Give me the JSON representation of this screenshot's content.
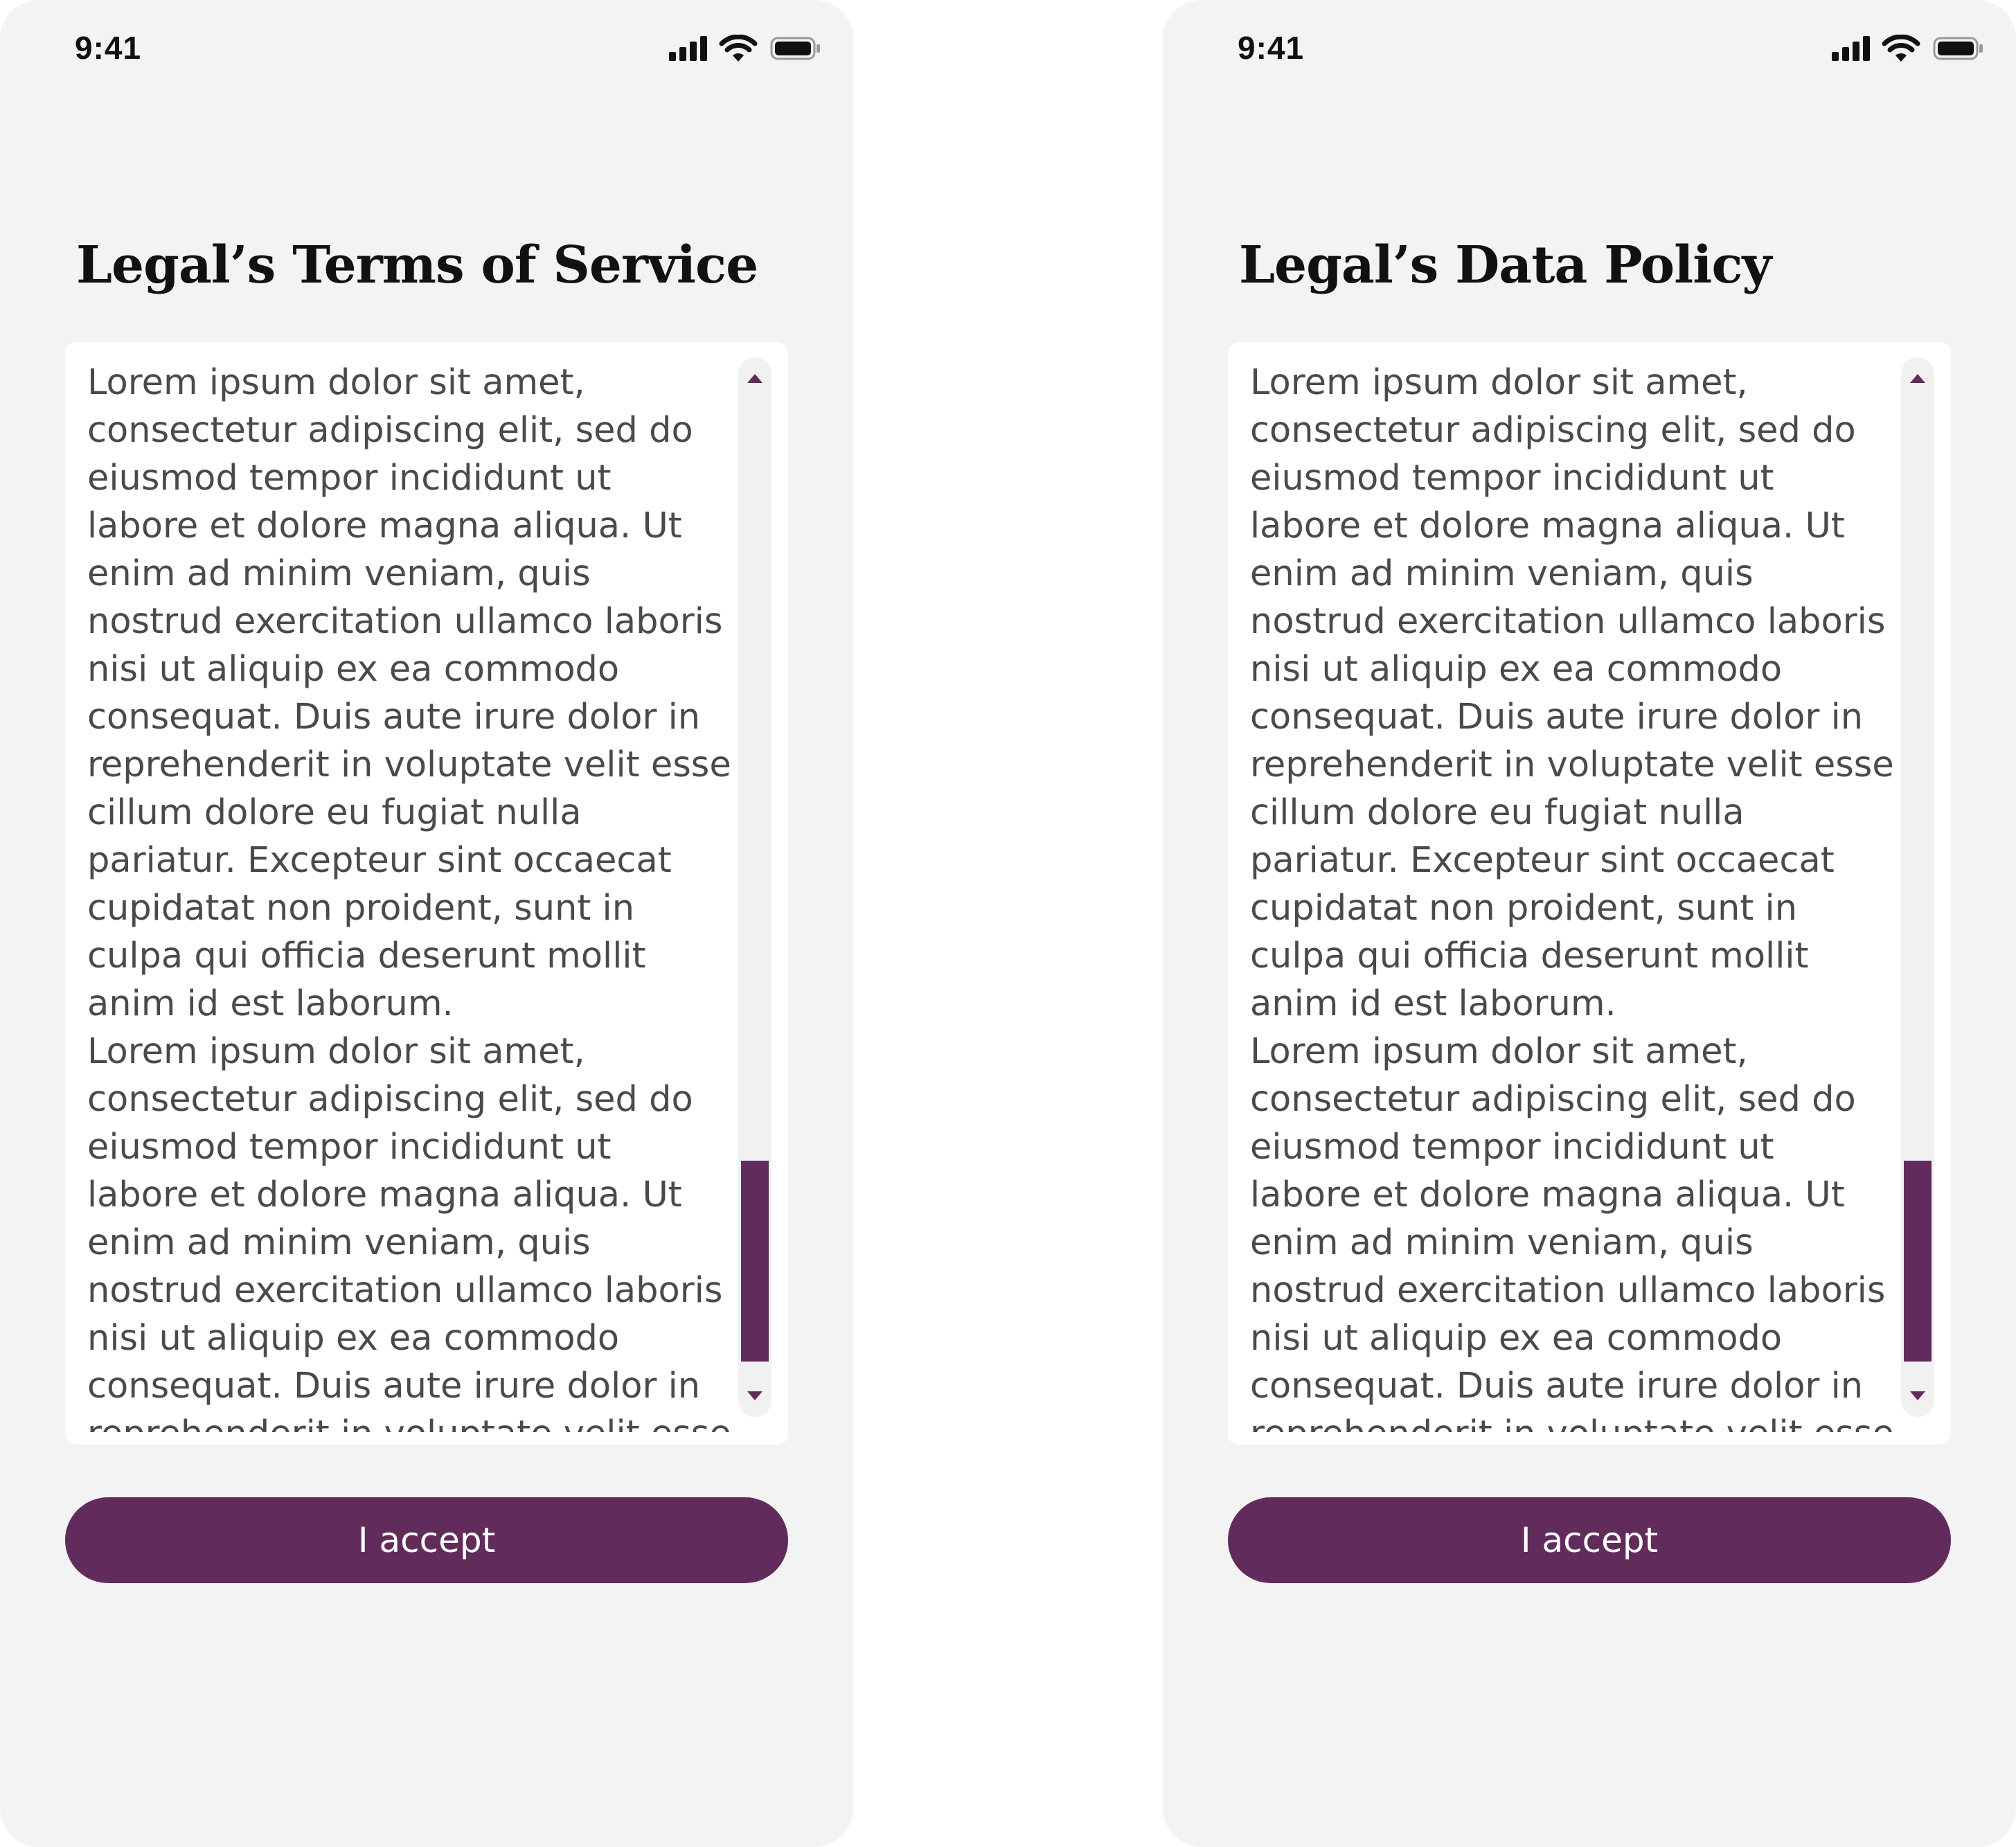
{
  "screens": [
    {
      "status_bar": {
        "time": "9:41",
        "icons": [
          "cellular-signal-icon",
          "wifi-icon",
          "battery-icon"
        ]
      },
      "title": "Legal’s Terms of Service",
      "body_text": "Lorem ipsum dolor sit amet, consectetur adipiscing elit, sed do eiusmod tempor incididunt ut labore et dolore magna aliqua. Ut enim ad minim veniam, quis nostrud exercitation ullamco laboris nisi ut aliquip ex ea commodo consequat. Duis aute irure dolor in reprehenderit in voluptate velit esse cillum dolore eu fugiat nulla pariatur. Excepteur sint occaecat cupidatat non proident, sunt in culpa qui officia deserunt mollit anim id est laborum.\nLorem ipsum dolor sit amet, consectetur adipiscing elit, sed do eiusmod tempor incididunt ut labore et dolore magna aliqua. Ut enim ad minim veniam, quis nostrud exercitation ullamco laboris nisi ut aliquip ex ea commodo consequat. Duis aute irure dolor in reprehenderit in voluptate velit esse cillum dolore",
      "accept_label": "I accept"
    },
    {
      "status_bar": {
        "time": "9:41",
        "icons": [
          "cellular-signal-icon",
          "wifi-icon",
          "battery-icon"
        ]
      },
      "title": "Legal’s Data Policy",
      "body_text": "Lorem ipsum dolor sit amet, consectetur adipiscing elit, sed do eiusmod tempor incididunt ut labore et dolore magna aliqua. Ut enim ad minim veniam, quis nostrud exercitation ullamco laboris nisi ut aliquip ex ea commodo consequat. Duis aute irure dolor in reprehenderit in voluptate velit esse cillum dolore eu fugiat nulla pariatur. Excepteur sint occaecat cupidatat non proident, sunt in culpa qui officia deserunt mollit anim id est laborum.\nLorem ipsum dolor sit amet, consectetur adipiscing elit, sed do eiusmod tempor incididunt ut labore et dolore magna aliqua. Ut enim ad minim veniam, quis nostrud exercitation ullamco laboris nisi ut aliquip ex ea commodo consequat. Duis aute irure dolor in reprehenderit in voluptate velit esse cillum dolore",
      "accept_label": "I accept"
    }
  ],
  "colors": {
    "accent": "#612b5c",
    "screen_background": "#f3f3f4",
    "card_background": "#ffffff",
    "body_text": "#4a4a4a",
    "title_text": "#111111"
  }
}
